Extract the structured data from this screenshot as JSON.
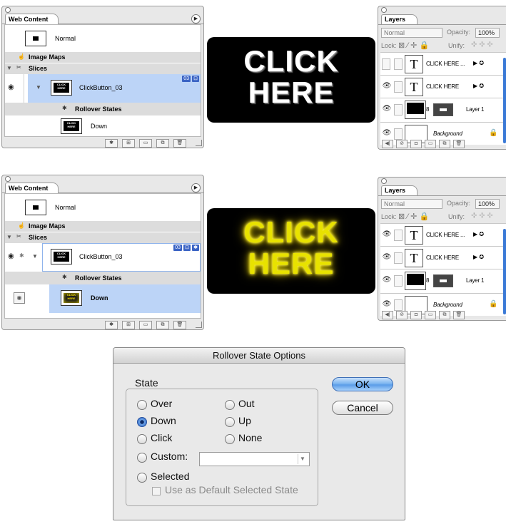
{
  "web_content": {
    "tab_title": "Web Content",
    "normal_label": "Normal",
    "image_maps_label": "Image Maps",
    "slices_label": "Slices",
    "slice_name": "ClickButton_03",
    "rollover_states_label": "Rollover States",
    "down_label": "Down",
    "thumb_text": "CLICK HERE",
    "badge_text": "03"
  },
  "preview": {
    "line1": "CLICK",
    "line2": "HERE"
  },
  "layers": {
    "tab_title": "Layers",
    "blend_mode": "Normal",
    "opacity_label": "Opacity:",
    "opacity_value": "100%",
    "lock_label": "Lock:",
    "unify_label": "Unify:",
    "rows": [
      {
        "name": "CLICK HERE ..."
      },
      {
        "name": "CLICK HERE"
      },
      {
        "name": "Layer 1"
      },
      {
        "name": "Background"
      }
    ]
  },
  "dialog": {
    "title": "Rollover State Options",
    "state_label": "State",
    "options": {
      "over": "Over",
      "out": "Out",
      "down": "Down",
      "up": "Up",
      "click": "Click",
      "none": "None",
      "custom": "Custom:",
      "selected": "Selected"
    },
    "selected_option": "Down",
    "default_selected_label": "Use as Default Selected State",
    "ok_label": "OK",
    "cancel_label": "Cancel"
  }
}
